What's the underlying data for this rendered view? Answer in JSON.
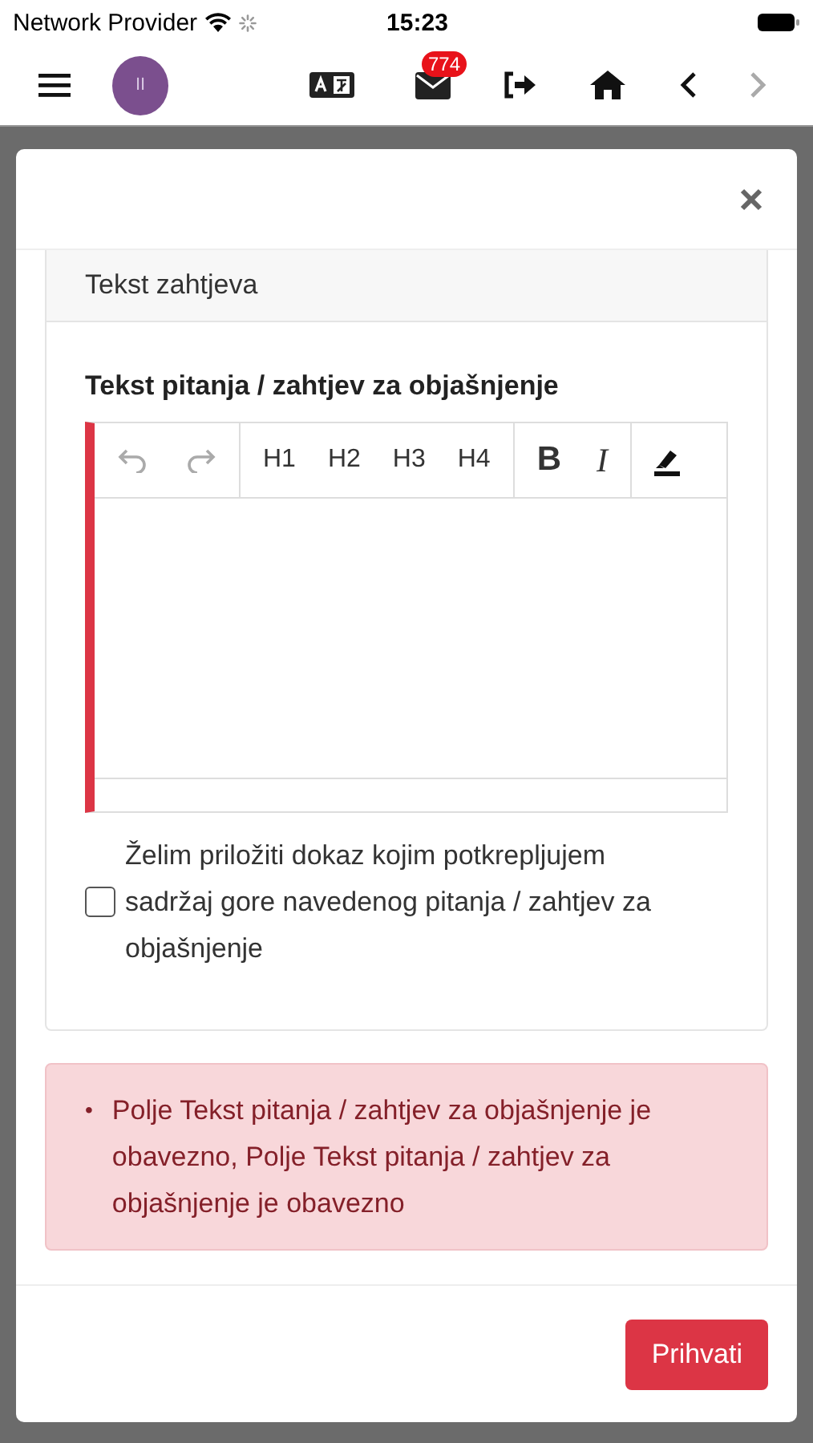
{
  "status_bar": {
    "carrier": "Network Provider",
    "time": "15:23"
  },
  "toolbar": {
    "avatar_initials": "II",
    "mail_badge": "774",
    "nav": [
      {
        "kind": "back",
        "disabled": false
      },
      {
        "kind": "forward",
        "disabled": true
      }
    ]
  },
  "modal": {
    "card_header": "Tekst zahtjeva",
    "field_label": "Tekst pitanja / zahtjev za objašnjenje",
    "editor": {
      "invalid": true,
      "history": [
        {
          "kind": "undo",
          "disabled": true
        },
        {
          "kind": "redo",
          "disabled": true
        }
      ],
      "headings": [
        "H1",
        "H2",
        "H3",
        "H4"
      ],
      "formats": [
        {
          "kind": "bold",
          "label": "B"
        },
        {
          "kind": "italic",
          "label": "I"
        }
      ]
    },
    "attachment": {
      "label": "Želim priložiti dokaz kojim potkrepljujem sadržaj gore navedenog pitanja / zahtjev za objašnjenje",
      "checked": false
    },
    "errors": [
      {
        "marker": "•",
        "text": "Polje Tekst pitanja / zahtjev za objašnjenje je obavezno, Polje Tekst pitanja / zahtjev za objašnjenje je obavezno"
      }
    ],
    "submit": "Prihvati"
  }
}
